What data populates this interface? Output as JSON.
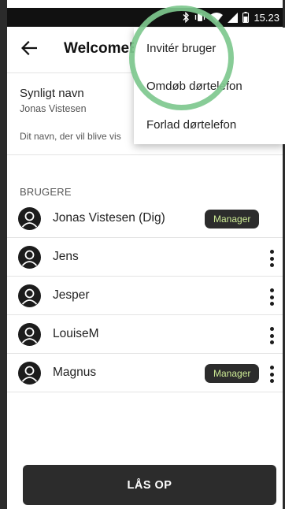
{
  "status_bar": {
    "time": "15.23",
    "icons": [
      "bluetooth-icon",
      "vibrate-icon",
      "wifi-icon",
      "signal-icon",
      "battery-icon"
    ]
  },
  "toolbar": {
    "title": "WelcomeE",
    "back_icon": "arrow-left-icon"
  },
  "profile": {
    "label": "Synligt navn",
    "value": "Jonas Vistesen",
    "hint": "Dit navn, der vil blive vis"
  },
  "users": {
    "header": "BRUGERE",
    "items": [
      {
        "name": "Jonas Vistesen (Dig)",
        "badge": "Manager",
        "has_menu": false
      },
      {
        "name": "Jens",
        "has_menu": true
      },
      {
        "name": "Jesper",
        "has_menu": true
      },
      {
        "name": "LouiseM",
        "has_menu": true
      },
      {
        "name": "Magnus",
        "badge": "Manager",
        "has_menu": true
      }
    ]
  },
  "unlock_button": {
    "label": "LÅS OP"
  },
  "overflow_menu": {
    "items": [
      "Invitér bruger",
      "Omdøb dørtelefon",
      "Forlad dørtelefon"
    ]
  },
  "colors": {
    "highlight": "#7ec88e",
    "badge_text": "#cdeb95",
    "dark": "#2c2c2c"
  }
}
